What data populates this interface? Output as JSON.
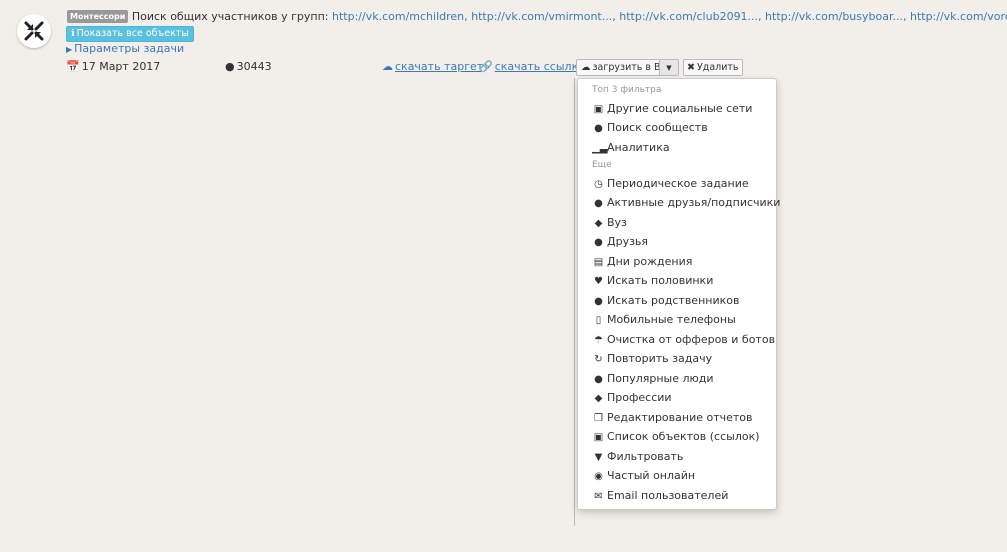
{
  "task": {
    "tag": "Монтессори",
    "title": "Поиск общих участников у групп:",
    "links": [
      "http://vk.com/mchildren,",
      "http://vk.com/vmirmont...,",
      "http://vk.com/club2091...,",
      "http://vk.com/busyboar...,",
      "http://vk.com/vorobyshik,"
    ],
    "show_all_label": "Показать все объекты",
    "params_label": "Параметры задачи",
    "date": "17 Март 2017",
    "count": "30443",
    "download_target": "скачать таргет",
    "download_links": "скачать ссылки",
    "upload_label": "загрузить в ВК",
    "delete_label": "Удалить"
  },
  "menu": {
    "top_header": "Топ 3 фильтра",
    "more_header": "Еще",
    "top_items": [
      {
        "label": "Другие социальные сети",
        "icon": "instagram-icon"
      },
      {
        "label": "Поиск сообществ",
        "icon": "users-icon"
      },
      {
        "label": "Аналитика",
        "icon": "signal-icon"
      }
    ],
    "more_items": [
      {
        "label": "Периодическое задание",
        "icon": "clock-icon"
      },
      {
        "label": "Активные друзья/подписчики",
        "icon": "user-icon"
      },
      {
        "label": "Вуз",
        "icon": "graduation-cap-icon"
      },
      {
        "label": "Друзья",
        "icon": "user-icon"
      },
      {
        "label": "Дни рождения",
        "icon": "gift-icon"
      },
      {
        "label": "Искать половинки",
        "icon": "heart-icon"
      },
      {
        "label": "Искать родственников",
        "icon": "users-icon"
      },
      {
        "label": "Мобильные телефоны",
        "icon": "mobile-icon"
      },
      {
        "label": "Очистка от офферов и ботов",
        "icon": "umbrella-icon"
      },
      {
        "label": "Повторить задачу",
        "icon": "refresh-icon"
      },
      {
        "label": "Популярные люди",
        "icon": "users-icon"
      },
      {
        "label": "Профессии",
        "icon": "graduation-cap-icon"
      },
      {
        "label": "Редактирование отчетов",
        "icon": "copy-icon"
      },
      {
        "label": "Список объектов (ссылок)",
        "icon": "save-icon"
      },
      {
        "label": "Фильтровать",
        "icon": "filter-icon"
      },
      {
        "label": "Частый онлайн",
        "icon": "eye-icon"
      },
      {
        "label": "Email пользователей",
        "icon": "envelope-icon"
      }
    ]
  }
}
